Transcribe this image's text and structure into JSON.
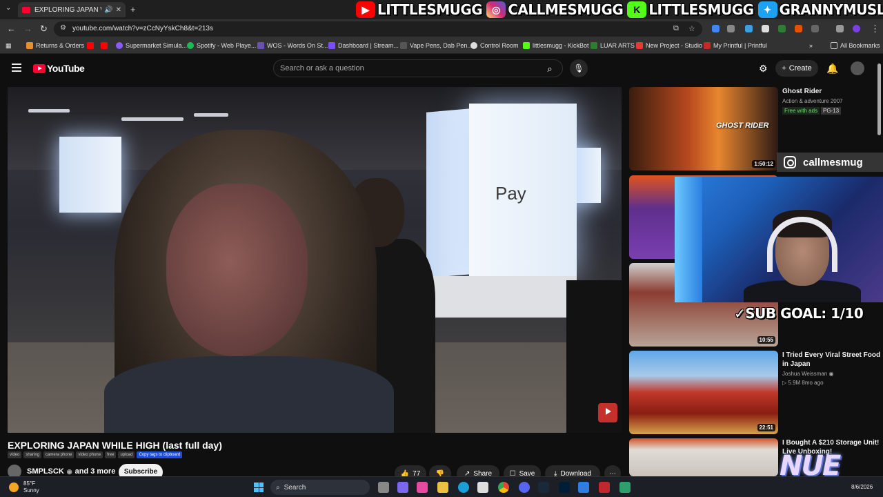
{
  "browser": {
    "tab_title": "EXPLORING JAPAN WHILE H",
    "url": "youtube.com/watch?v=zCcNyYskCh8&t=213s",
    "bookmarks": [
      "Returns & Orders",
      "Supermarket Simula...",
      "Spotify - Web Playe...",
      "WOS - Words On St...",
      "Dashboard | Stream...",
      "Vape Pens, Dab Pen...",
      "Control Room",
      "littlesmugg - KickBot",
      "LUAR ARTS",
      "New Project - Studio",
      "My Printful | Printful"
    ],
    "all_bookmarks": "All Bookmarks"
  },
  "overlay": {
    "socials": [
      {
        "platform": "youtube",
        "handle": "LITTLESMUGG",
        "color": "#ff0000"
      },
      {
        "platform": "instagram",
        "handle": "CALLMESMUGG",
        "color": "#d62976"
      },
      {
        "platform": "kick",
        "handle": "LITTLESMUGG",
        "color": "#53fc18"
      },
      {
        "platform": "twitter",
        "handle": "GRANNYMUSLIM",
        "color": "#1da1f2"
      }
    ],
    "instagram_box": "callmesmug",
    "sub_goal": "SUB GOAL: 1/10",
    "nue": "NUE"
  },
  "youtube": {
    "logo": "YouTube",
    "search_placeholder": "Search or ask a question",
    "create_label": "Create",
    "video": {
      "title": "EXPLORING JAPAN WHILE HIGH (last full day)",
      "tags": [
        "video",
        "sharing",
        "camera phone",
        "video phone",
        "free",
        "upload"
      ],
      "copy_tags": "Copy tags to clipboard",
      "channel": "SMPLSCK",
      "collab": "and 3 more",
      "subscribe": "Subscribe",
      "likes": "77",
      "share": "Share",
      "save": "Save",
      "download": "Download",
      "scene_sign": "Pay"
    },
    "recommendations": [
      {
        "title": "Ghost Rider",
        "meta": "Action & adventure 2007",
        "free": "Free with ads",
        "rating": "PG-13",
        "duration": "1:50:12",
        "thumb_text": "GHOST RIDER"
      },
      {
        "title": "",
        "duration": ""
      },
      {
        "title": "",
        "duration": "10:55"
      },
      {
        "title": "I Tried Every Viral Street Food in Japan",
        "channel": "Joshua Weissman",
        "stats": "5.9M  8mo ago",
        "duration": "22:51"
      },
      {
        "title": "I Bought A $210 Storage Unit! Live Unboxing!",
        "duration": ""
      }
    ]
  },
  "taskbar": {
    "temp": "85°F",
    "condition": "Sunny",
    "search": "Search",
    "date": "8/6/2026"
  }
}
